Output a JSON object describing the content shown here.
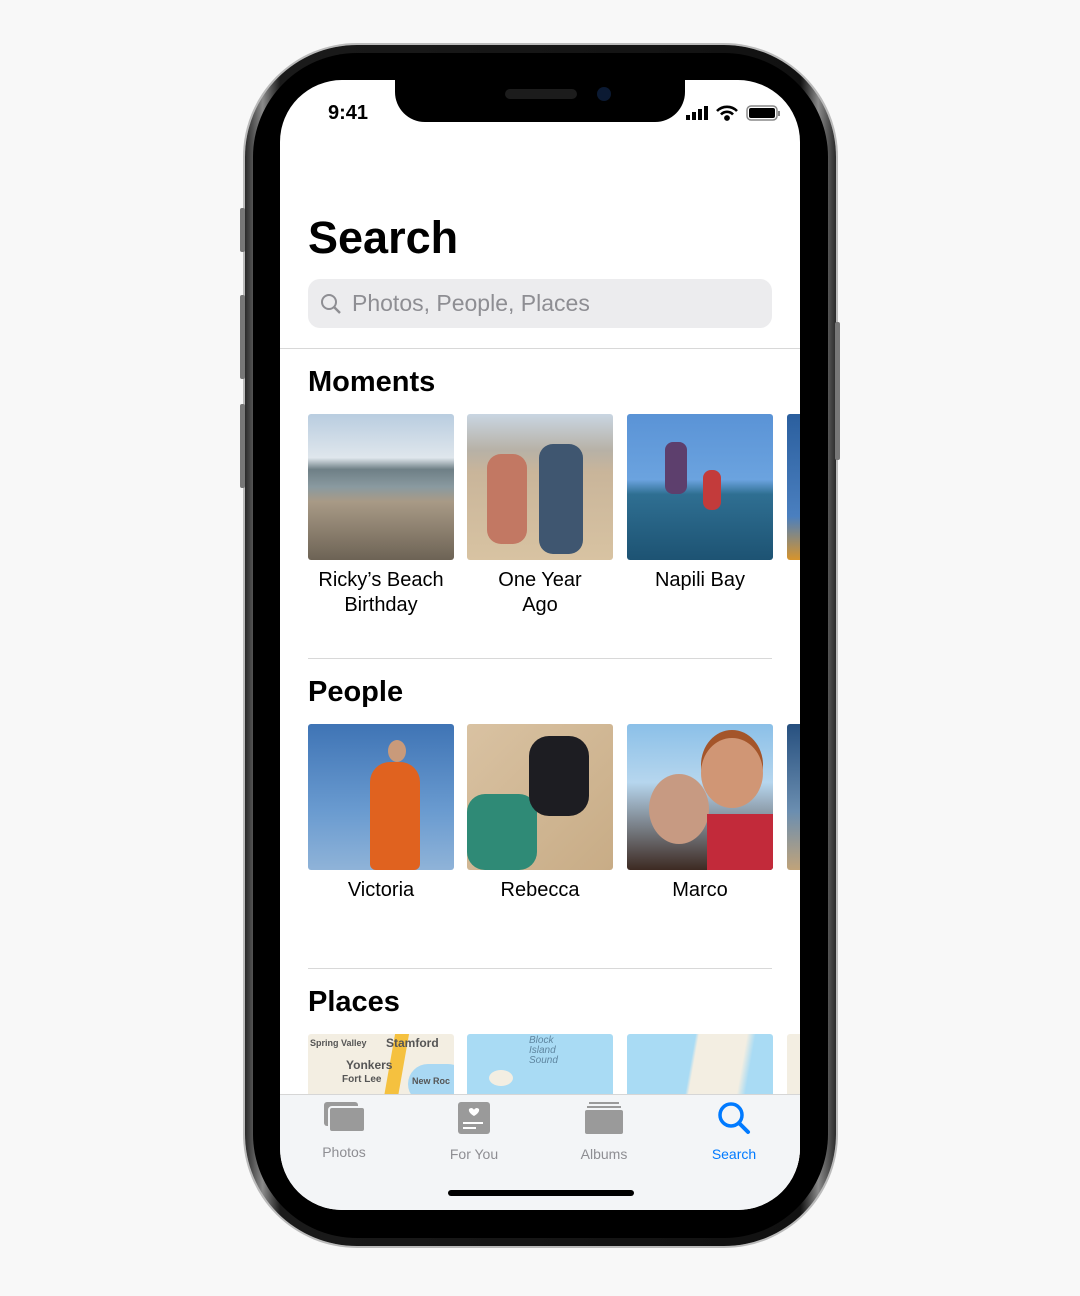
{
  "status_bar": {
    "time": "9:41",
    "icons": [
      "cellular-signal-icon",
      "wifi-icon",
      "battery-icon"
    ]
  },
  "header": {
    "title": "Search"
  },
  "search": {
    "placeholder": "Photos, People, Places",
    "icon": "magnifier-icon"
  },
  "sections": {
    "moments": {
      "title": "Moments",
      "items": [
        {
          "label": "Ricky’s Beach Birthday"
        },
        {
          "label": "One Year Ago"
        },
        {
          "label": "Napili Bay"
        }
      ]
    },
    "people": {
      "title": "People",
      "items": [
        {
          "label": "Victoria"
        },
        {
          "label": "Rebecca"
        },
        {
          "label": "Marco"
        }
      ]
    },
    "places": {
      "title": "Places",
      "map_labels": [
        "Spring Valley",
        "Stamford",
        "Yonkers",
        "Fort Lee",
        "New Roc",
        "Block",
        "Island",
        "Sound"
      ]
    }
  },
  "tabbar": {
    "items": [
      {
        "label": "Photos",
        "icon": "photos-icon"
      },
      {
        "label": "For You",
        "icon": "for-you-icon"
      },
      {
        "label": "Albums",
        "icon": "albums-icon"
      },
      {
        "label": "Search",
        "icon": "search-icon",
        "active": true
      }
    ]
  },
  "colors": {
    "accent": "#007aff",
    "inactive": "#8e8e93"
  }
}
